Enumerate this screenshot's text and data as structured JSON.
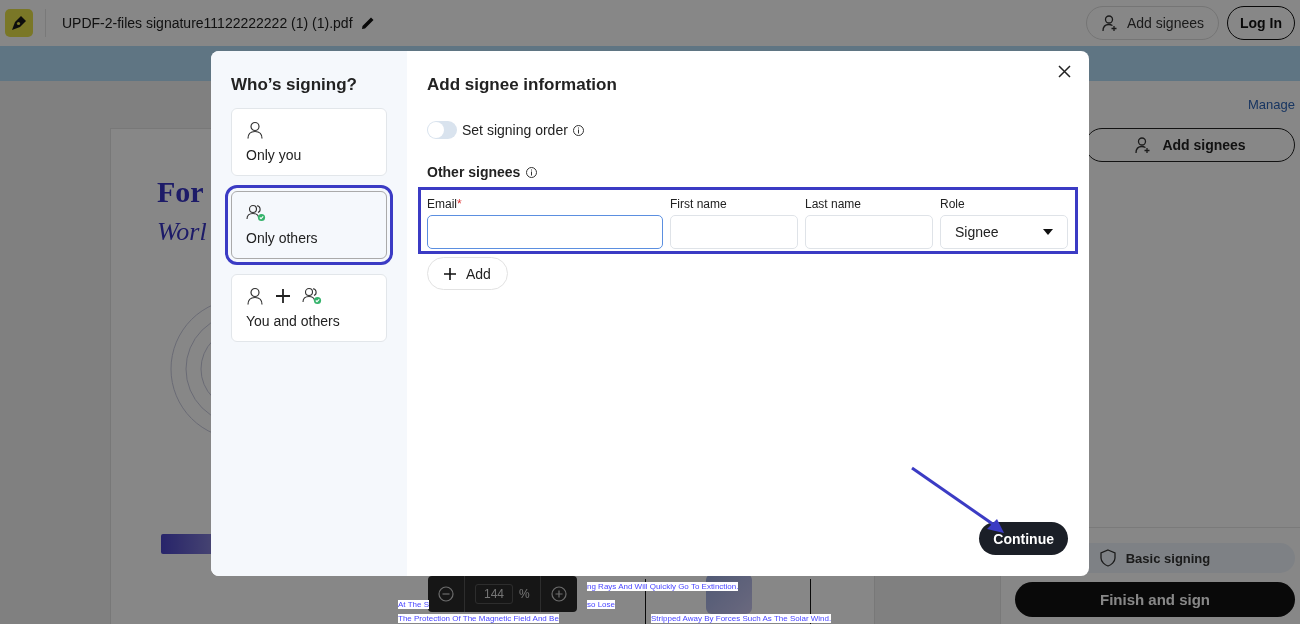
{
  "header": {
    "filename": "UPDF-2-files signature11122222222 (1) (1).pdf",
    "add_signees": "Add signees",
    "login": "Log In"
  },
  "document": {
    "title": "For",
    "subtitle": "Worl",
    "fragments": [
      {
        "text": "ng Rays And Will Quickly Go To Extinction."
      },
      {
        "text": "At The S"
      },
      {
        "text": "so Lose"
      },
      {
        "text": "The Protection Of The Magnetic Field And Be"
      },
      {
        "text": "Stripped Away By Forces Such As The Solar Wind."
      }
    ]
  },
  "zoom": {
    "value": "144",
    "unit": "%"
  },
  "sidebar": {
    "manage": "Manage",
    "add_signees": "Add signees",
    "basic_signing": "Basic signing",
    "finish": "Finish and sign"
  },
  "dialog": {
    "heading": "Who’s signing?",
    "options": [
      {
        "label": "Only you",
        "kind": "you",
        "selected": false
      },
      {
        "label": "Only others",
        "kind": "others",
        "selected": true
      },
      {
        "label": "You and others",
        "kind": "both",
        "selected": false
      }
    ],
    "title": "Add signee information",
    "signing_order": {
      "label": "Set signing order",
      "on": false
    },
    "others_label": "Other signees",
    "fields": [
      {
        "label": "Email",
        "required_mark": "*",
        "kind": "text",
        "focused": true
      },
      {
        "label": "First name",
        "kind": "text",
        "focused": false
      },
      {
        "label": "Last name",
        "kind": "text",
        "focused": false
      },
      {
        "label": "Role",
        "kind": "select",
        "value": "Signee",
        "focused": false
      }
    ],
    "add": "Add",
    "continue": "Continue"
  }
}
